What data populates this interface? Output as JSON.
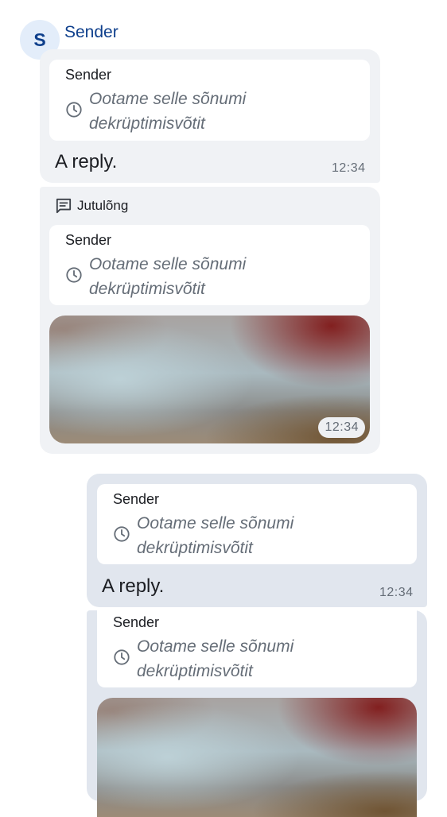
{
  "sender": {
    "avatar_letter": "S",
    "name": "Sender"
  },
  "messages": [
    {
      "reply": {
        "sender": "Sender",
        "text": "Ootame selle sõnumi dekrüptimisvõtit",
        "icon": "clock-icon"
      },
      "body": "A reply.",
      "time": "12:34"
    },
    {
      "thread_label": "Jutulõng",
      "thread_icon": "thread-icon",
      "reply": {
        "sender": "Sender",
        "text": "Ootame selle sõnumi dekrüptimisvõtit",
        "icon": "clock-icon"
      },
      "image": "blurred-image",
      "time": "12:34"
    },
    {
      "reply": {
        "sender": "Sender",
        "text": "Ootame selle sõnumi dekrüptimisvõtit",
        "icon": "clock-icon"
      },
      "body": "A reply.",
      "time": "12:34"
    },
    {
      "reply": {
        "sender": "Sender",
        "text": "Ootame selle sõnumi dekrüptimisvõtit",
        "icon": "clock-icon"
      },
      "image": "blurred-image"
    }
  ],
  "colors": {
    "accent": "#0e3f8c",
    "avatar_bg": "#e3edfa",
    "bubble_incoming": "#f0f2f5",
    "bubble_outgoing": "#e1e6ee",
    "secondary_text": "#656d77"
  }
}
